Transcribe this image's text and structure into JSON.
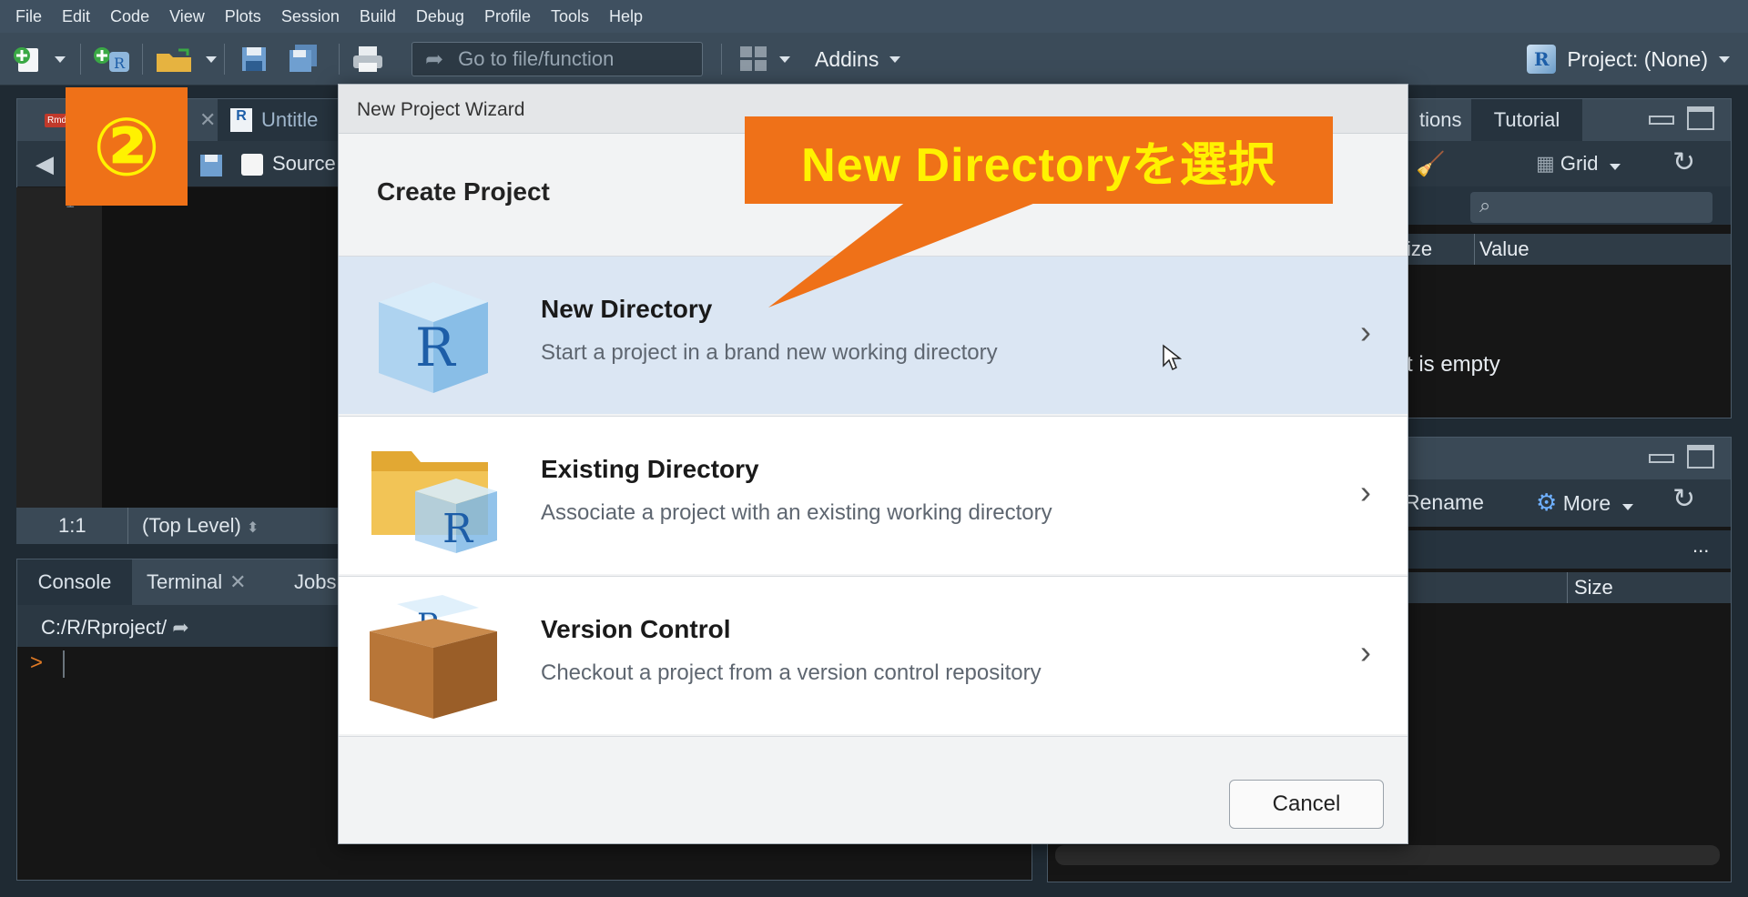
{
  "menu": [
    "File",
    "Edit",
    "Code",
    "View",
    "Plots",
    "Session",
    "Build",
    "Debug",
    "Profile",
    "Tools",
    "Help"
  ],
  "toolbar": {
    "goto_placeholder": "Go to file/function",
    "addins_label": "Addins",
    "project_label": "Project: (None)"
  },
  "editor": {
    "tabs": [
      "Untitle"
    ],
    "source_label": "Source",
    "line_number": "1",
    "position": "1:1",
    "scope": "(Top Level)"
  },
  "badge": {
    "text": "②"
  },
  "console": {
    "tabs": [
      "Console",
      "Terminal",
      "Jobs"
    ],
    "path": "C:/R/Rproject/",
    "prompt": ">"
  },
  "env_pane": {
    "tabs": [
      "tions",
      "Tutorial"
    ],
    "grid_label": "Grid",
    "col_size": "ize",
    "col_value": "Value",
    "empty_msg": "t is empty"
  },
  "files_pane": {
    "rename_label": "Rename",
    "more_label": "More",
    "col_size": "Size",
    "ellipsis": "..."
  },
  "dialog": {
    "title": "New Project Wizard",
    "heading": "Create Project",
    "options": [
      {
        "title": "New Directory",
        "desc": "Start a project in a brand new working directory",
        "icon": "r-cube-icon"
      },
      {
        "title": "Existing Directory",
        "desc": "Associate a project with an existing working directory",
        "icon": "folder-r-icon"
      },
      {
        "title": "Version Control",
        "desc": "Checkout a project from a version control repository",
        "icon": "box-r-icon"
      }
    ],
    "cancel_label": "Cancel"
  },
  "callout": {
    "text": "New  Directoryを選択"
  },
  "colors": {
    "accent_orange": "#ef7118",
    "callout_text": "#fff200",
    "selected_row": "#dbe6f3"
  }
}
